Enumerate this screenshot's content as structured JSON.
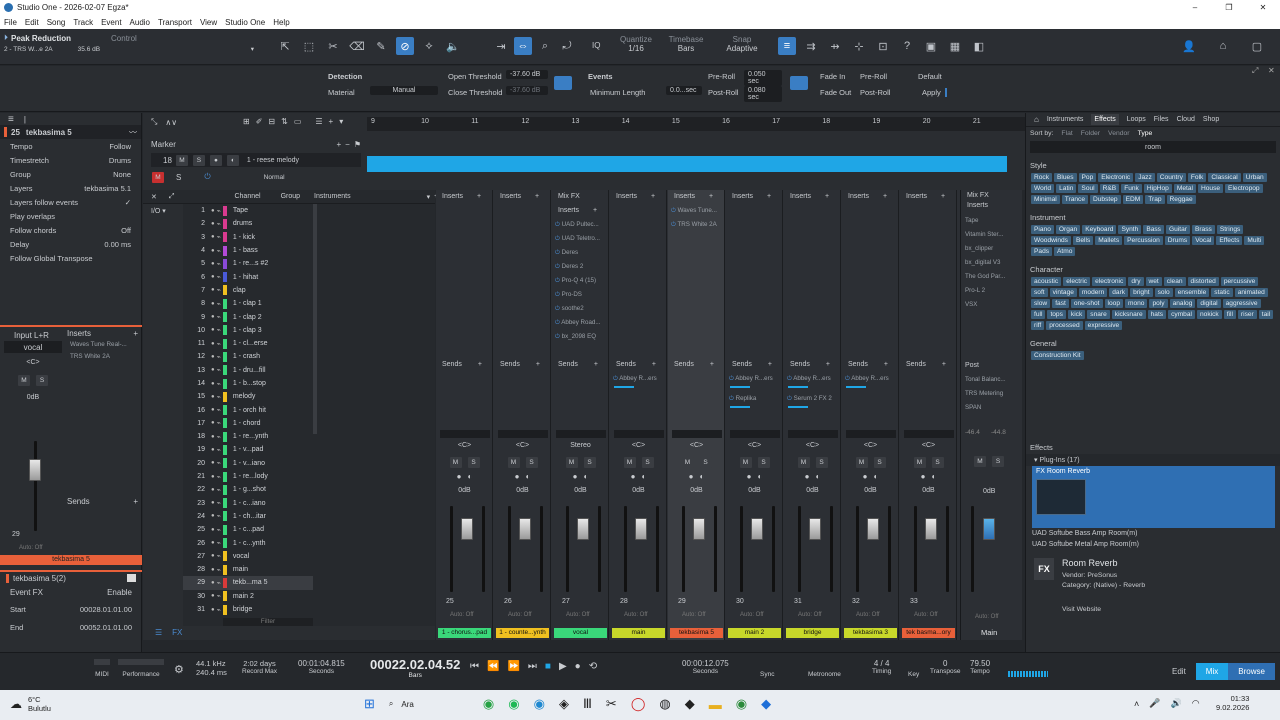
{
  "window": {
    "title": "Studio One - 2026-02-07 Egza*",
    "controls": [
      "–",
      "❐",
      "✕"
    ]
  },
  "menu": [
    "File",
    "Edit",
    "Song",
    "Track",
    "Event",
    "Audio",
    "Transport",
    "View",
    "Studio One",
    "Help"
  ],
  "toolbar": {
    "preset_name": "Peak Reduction",
    "preset_sub": "2 - TRS W...e 2A",
    "preset_val": "35.6 dB",
    "control_label": "Control",
    "quantize_label": "Quantize",
    "quantize_val": "1/16",
    "timebase_label": "Timebase",
    "timebase_val": "Bars",
    "snap_label": "Snap",
    "snap_val": "Adaptive",
    "iq_label": "IQ"
  },
  "infobar": {
    "detection_label": "Detection",
    "material_label": "Material",
    "material_val": "Manual",
    "open_thr_label": "Open Threshold",
    "open_thr_val": "-37.60 dB",
    "close_thr_label": "Close Threshold",
    "close_thr_val": "-37.60 dB",
    "events_label": "Events",
    "min_len_label": "Minimum Length",
    "min_len_val": "0.0...sec",
    "preroll_label": "Pre-Roll",
    "preroll_val": "0.050 sec",
    "postroll_label": "Post-Roll",
    "postroll_val": "0.080 sec",
    "fadein_label": "Fade In",
    "fadeout_label": "Fade Out",
    "preroll_btn": "Pre-Roll",
    "postroll_btn": "Post-Roll",
    "default_btn": "Default",
    "apply_btn": "Apply"
  },
  "inspector": {
    "track_num": "25",
    "track_name": "tekbasima 5",
    "rows": [
      {
        "label": "Tempo",
        "value": "Follow"
      },
      {
        "label": "Timestretch",
        "value": "Drums"
      },
      {
        "label": "Group",
        "value": "None"
      },
      {
        "label": "Layers",
        "value": "tekbasima 5.1"
      },
      {
        "label": "Layers follow events",
        "value": "✓"
      },
      {
        "label": "Play overlaps",
        "value": ""
      },
      {
        "label": "Follow chords",
        "value": "Off"
      },
      {
        "label": "Delay",
        "value": "0.00 ms"
      },
      {
        "label": "Follow Global Transpose",
        "value": ""
      }
    ],
    "input": "Input L+R",
    "input_name": "vocal",
    "inserts_label": "Inserts",
    "inserts": [
      "Waves Tune Real-...",
      "TRS White 2A"
    ],
    "sends_label": "Sends",
    "db": "0dB",
    "ch_num": "29",
    "auto": "Auto: Off",
    "channel_name": "tekbasima 5",
    "event_section": "tekbasima 5(2)",
    "event_fx_label": "Event FX",
    "enable_label": "Enable",
    "start_label": "Start",
    "start_val": "00028.01.01.00",
    "end_label": "End",
    "end_val": "00052.01.01.00"
  },
  "arranger": {
    "marker_label": "Marker",
    "ruler": [
      "9",
      "10",
      "11",
      "12",
      "13",
      "14",
      "15",
      "16",
      "17",
      "18",
      "19",
      "20",
      "21"
    ],
    "clip_label": "1 - reese melody",
    "normal_label": "Normal",
    "track_num_top": "18"
  },
  "tracklist": {
    "headers": [
      "Channel",
      "Group",
      "Instruments"
    ],
    "rows": [
      {
        "n": "1",
        "name": "Tape",
        "c": "#d93a8f"
      },
      {
        "n": "2",
        "name": "drums",
        "c": "#d93a8f"
      },
      {
        "n": "3",
        "name": "1 - kick",
        "c": "#d93a8f"
      },
      {
        "n": "4",
        "name": "1 - bass",
        "c": "#b34ad8"
      },
      {
        "n": "5",
        "name": "1 - re...s #2",
        "c": "#8a4ad8"
      },
      {
        "n": "6",
        "name": "1 - hihat",
        "c": "#4a5ad8"
      },
      {
        "n": "7",
        "name": "clap",
        "c": "#f0c020"
      },
      {
        "n": "8",
        "name": "1 - clap 1",
        "c": "#3ad87a"
      },
      {
        "n": "9",
        "name": "1 - clap 2",
        "c": "#3ad87a"
      },
      {
        "n": "10",
        "name": "1 - clap 3",
        "c": "#3ad87a"
      },
      {
        "n": "11",
        "name": "1 - cl...erse",
        "c": "#3ad87a"
      },
      {
        "n": "12",
        "name": "1 - crash",
        "c": "#3ad87a"
      },
      {
        "n": "13",
        "name": "1 - dru...fill",
        "c": "#3ad87a"
      },
      {
        "n": "14",
        "name": "1 - b...stop",
        "c": "#3ad87a"
      },
      {
        "n": "15",
        "name": "melody",
        "c": "#f0c020"
      },
      {
        "n": "16",
        "name": "1 - orch hit",
        "c": "#3ad87a"
      },
      {
        "n": "17",
        "name": "1 - chord",
        "c": "#3ad87a"
      },
      {
        "n": "18",
        "name": "1 - re...ynth",
        "c": "#3ad87a"
      },
      {
        "n": "19",
        "name": "1 - v...pad",
        "c": "#3ad87a"
      },
      {
        "n": "20",
        "name": "1 - v...iano",
        "c": "#3ad87a"
      },
      {
        "n": "21",
        "name": "1 - re...lody",
        "c": "#3ad87a"
      },
      {
        "n": "22",
        "name": "1 - g...shot",
        "c": "#3ad87a"
      },
      {
        "n": "23",
        "name": "1 - c...iano",
        "c": "#3ad87a"
      },
      {
        "n": "24",
        "name": "1 - ch...itar",
        "c": "#3ad87a"
      },
      {
        "n": "25",
        "name": "1 - c...pad",
        "c": "#3ad87a"
      },
      {
        "n": "26",
        "name": "1 - c...ynth",
        "c": "#3ad87a"
      },
      {
        "n": "27",
        "name": "vocal",
        "c": "#f0c020"
      },
      {
        "n": "28",
        "name": "main",
        "c": "#f0c020"
      },
      {
        "n": "29",
        "name": "tekb...ma 5",
        "c": "#d93a3a"
      },
      {
        "n": "30",
        "name": "main 2",
        "c": "#f0c020"
      },
      {
        "n": "31",
        "name": "bridge",
        "c": "#f0c020"
      }
    ],
    "filter_placeholder": "Filter"
  },
  "mixer": {
    "strips": [
      {
        "num": "25",
        "name": "1 - chorus...pad",
        "color": "#3ad87a",
        "inserts": [],
        "sends": [],
        "route": "<C>"
      },
      {
        "num": "26",
        "name": "1 - counte...ynth",
        "color": "#f0c020",
        "inserts": [],
        "sends": [],
        "route": "<C>"
      },
      {
        "num": "27",
        "name": "vocal",
        "color": "#3ad87a",
        "title": "Mix FX",
        "inserts": [
          "UAD Pultec...",
          "UAD Teletro...",
          "Deres",
          "Deres 2",
          "Pro-Q 4 (15)",
          "Pro-DS",
          "soothe2",
          "Abbey Road...",
          "bx_2098 EQ"
        ],
        "sends": [],
        "route": "Stereo"
      },
      {
        "num": "28",
        "name": "main",
        "color": "#c8d82a",
        "inserts": [],
        "sends": [
          "Abbey R...ers"
        ],
        "route": "<C>"
      },
      {
        "num": "29",
        "name": "tekbasima 5",
        "color": "#e8603a",
        "inserts": [
          "Waves Tune...",
          "TRS White 2A"
        ],
        "sends": [],
        "route": "<C>"
      },
      {
        "num": "30",
        "name": "main 2",
        "color": "#c8d82a",
        "inserts": [],
        "sends": [
          "Abbey R...ers",
          "Replika"
        ],
        "route": "<C>"
      },
      {
        "num": "31",
        "name": "bridge",
        "color": "#c8d82a",
        "inserts": [],
        "sends": [
          "Abbey R...ers",
          "Serum 2 FX 2"
        ],
        "route": "<C>"
      },
      {
        "num": "32",
        "name": "tekbasima 3",
        "color": "#c8d82a",
        "inserts": [],
        "sends": [
          "Abbey R...ers"
        ],
        "route": "<C>"
      },
      {
        "num": "33",
        "name": "tek basma...ory",
        "color": "#e8603a",
        "inserts": [],
        "sends": [],
        "route": "<C>"
      }
    ],
    "main": {
      "name": "Main",
      "title": "Mix FX",
      "inserts": [
        "Tape",
        "Vitamin Ster...",
        "bx_clipper",
        "bx_digital V3",
        "The God Par...",
        "Pro-L 2",
        "VSX"
      ],
      "post_label": "Post",
      "post": [
        "Tonal Balanc...",
        "TRS Metering",
        "SPAN"
      ],
      "peak": "-46.4",
      "peak2": "-44.8"
    },
    "labels": {
      "inserts": "Inserts",
      "sends": "Sends",
      "db": "0dB",
      "auto": "Auto: Off"
    }
  },
  "browser": {
    "tabs": [
      "Instruments",
      "Effects",
      "Loops",
      "Files",
      "Cloud",
      "Shop"
    ],
    "sort_label": "Sort by:",
    "sort_opts": [
      "Flat",
      "Folder",
      "Vendor",
      "Type"
    ],
    "search_val": "room",
    "style_label": "Style",
    "style_tags": [
      "Rock",
      "Blues",
      "Pop",
      "Electronic",
      "Jazz",
      "Country",
      "Folk",
      "Classical",
      "Urban",
      "World",
      "Latin",
      "Soul",
      "R&B",
      "Funk",
      "HipHop",
      "Metal",
      "House",
      "Electropop",
      "Minimal",
      "Trance",
      "Dubstep",
      "EDM",
      "Trap",
      "Reggae"
    ],
    "instrument_label": "Instrument",
    "instrument_tags": [
      "Piano",
      "Organ",
      "Keyboard",
      "Synth",
      "Bass",
      "Guitar",
      "Brass",
      "Strings",
      "Woodwinds",
      "Bells",
      "Mallets",
      "Percussion",
      "Drums",
      "Vocal",
      "Effects",
      "Multi",
      "Pads",
      "Atmo"
    ],
    "character_label": "Character",
    "character_tags": [
      "acoustic",
      "electric",
      "electronic",
      "dry",
      "wet",
      "clean",
      "distorted",
      "percussive",
      "soft",
      "vintage",
      "modern",
      "dark",
      "bright",
      "solo",
      "ensemble",
      "static",
      "animated",
      "slow",
      "fast",
      "one-shot",
      "loop",
      "mono",
      "poly",
      "analog",
      "digital",
      "aggressive",
      "full",
      "tops",
      "kick",
      "snare",
      "kicksnare",
      "hats",
      "cymbal",
      "nokick",
      "fill",
      "riser",
      "tail",
      "riff",
      "processed",
      "expressive"
    ],
    "general_label": "General",
    "general_tags": [
      "Construction Kit"
    ],
    "effects_label": "Effects",
    "plugins_label": "Plug-Ins (17)",
    "results": [
      "Room Reverb",
      "UAD Softube Bass Amp Room(m)",
      "UAD Softube Metal Amp Room(m)"
    ],
    "detail_title": "Room Reverb",
    "detail_vendor": "Vendor:    PreSonus",
    "detail_category": "Category:  (Native) - Reverb",
    "visit": "Visit Website",
    "fx_badge": "FX"
  },
  "transport": {
    "midi_label": "MIDI",
    "perf_label": "Performance",
    "sample_rate": "44.1 kHz",
    "latency": "240.4 ms",
    "record_len": "2:02 days",
    "record_max": "Record Max",
    "seconds_val": "00:01:04.815",
    "seconds_label": "Seconds",
    "main_time": "00022.02.04.52",
    "bars_label": "Bars",
    "loop_time": "00:00:12.075",
    "loop_label": "Seconds",
    "sync_label": "Sync",
    "metronome_label": "Metronome",
    "timing_val": "4 / 4",
    "timing_label": "Timing",
    "key_label": "Key",
    "transpose_val": "0",
    "transpose_label": "Transpose",
    "tempo_val": "79.50",
    "tempo_label": "Tempo",
    "edit_btn": "Edit",
    "mix_btn": "Mix",
    "browse_btn": "Browse"
  },
  "taskbar": {
    "weather_temp": "6°C",
    "weather_desc": "Bulutlu",
    "search_placeholder": "Ara",
    "time": "01:33",
    "date": "9.02.2026"
  }
}
